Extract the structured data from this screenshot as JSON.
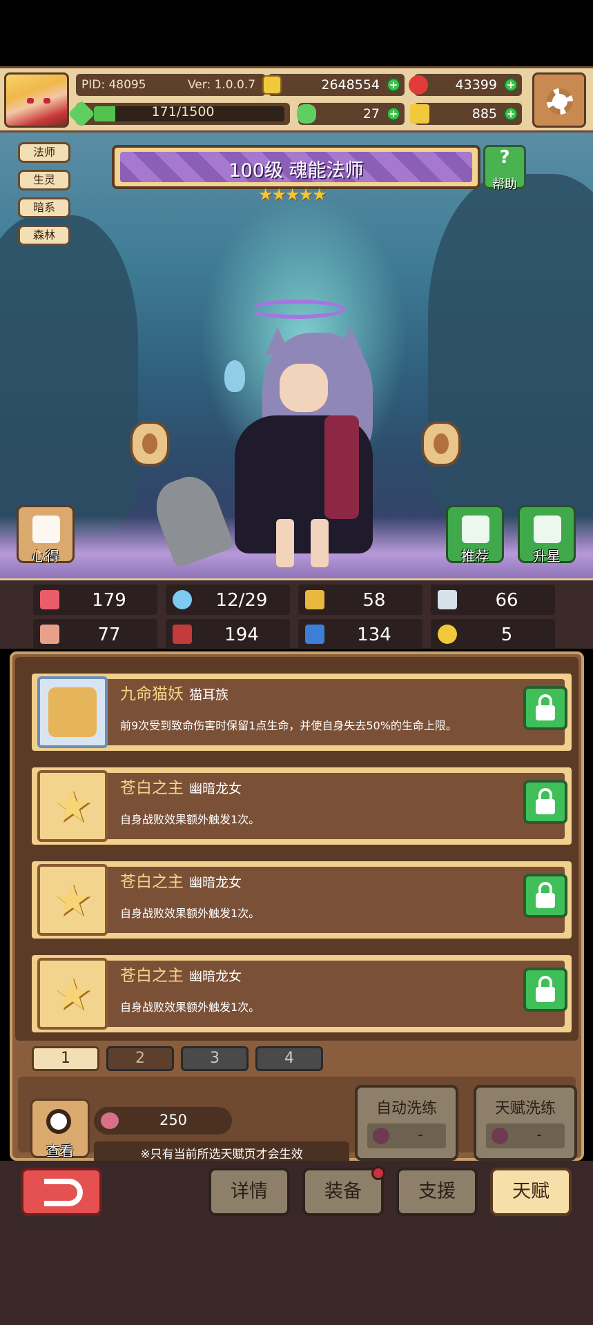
{
  "header": {
    "pid": "PID: 48095",
    "version": "Ver: 1.0.0.7",
    "coins": "2648554",
    "gems": "43399",
    "stamina": "171/1500",
    "stamina_fraction": 0.114,
    "clovers": "27",
    "keys": "885"
  },
  "character": {
    "tags": [
      "法师",
      "生灵",
      "暗系",
      "森林"
    ],
    "title": "100级  魂能法师",
    "stars": 5,
    "stars_text": "★★★★★",
    "help_label": "帮助",
    "notes_label": "心得",
    "recommend_label": "推荐",
    "upgrade_label": "升星"
  },
  "stats": [
    {
      "icon": "heart-icon",
      "value": "179"
    },
    {
      "icon": "water-drop-icon",
      "value": "12/29"
    },
    {
      "icon": "shield-icon",
      "value": "58"
    },
    {
      "icon": "wing-icon",
      "value": "66"
    },
    {
      "icon": "fist-icon",
      "value": "77"
    },
    {
      "icon": "book-icon",
      "value": "194"
    },
    {
      "icon": "boot-icon",
      "value": "134"
    },
    {
      "icon": "horseshoe-icon",
      "value": "5"
    }
  ],
  "talents": [
    {
      "name": "九命猫妖",
      "race": "猫耳族",
      "desc": "前9次受到致命伤害时保留1点生命，并使自身失去50%的生命上限。"
    },
    {
      "name": "苍白之主",
      "race": "幽暗龙女",
      "desc": "自身战败效果额外触发1次。"
    },
    {
      "name": "苍白之主",
      "race": "幽暗龙女",
      "desc": "自身战败效果额外触发1次。"
    },
    {
      "name": "苍白之主",
      "race": "幽暗龙女",
      "desc": "自身战败效果额外触发1次。"
    }
  ],
  "tabs": [
    "1",
    "2",
    "3",
    "4"
  ],
  "bottom": {
    "view_label": "查看",
    "cost": "250",
    "note": "※只有当前所选天赋页才会生效",
    "auto_wash_label": "自动洗练",
    "auto_wash_count": "-",
    "talent_wash_label": "天赋洗练",
    "talent_wash_count": "-"
  },
  "nav": {
    "details": "详情",
    "equipment": "装备",
    "support": "支援",
    "talent": "天赋"
  },
  "colors": {
    "plus_green": "#3fbf4a",
    "lock_green": "#3fbf58",
    "title_purple": "#8c5fb6",
    "back_red": "#e55050"
  }
}
